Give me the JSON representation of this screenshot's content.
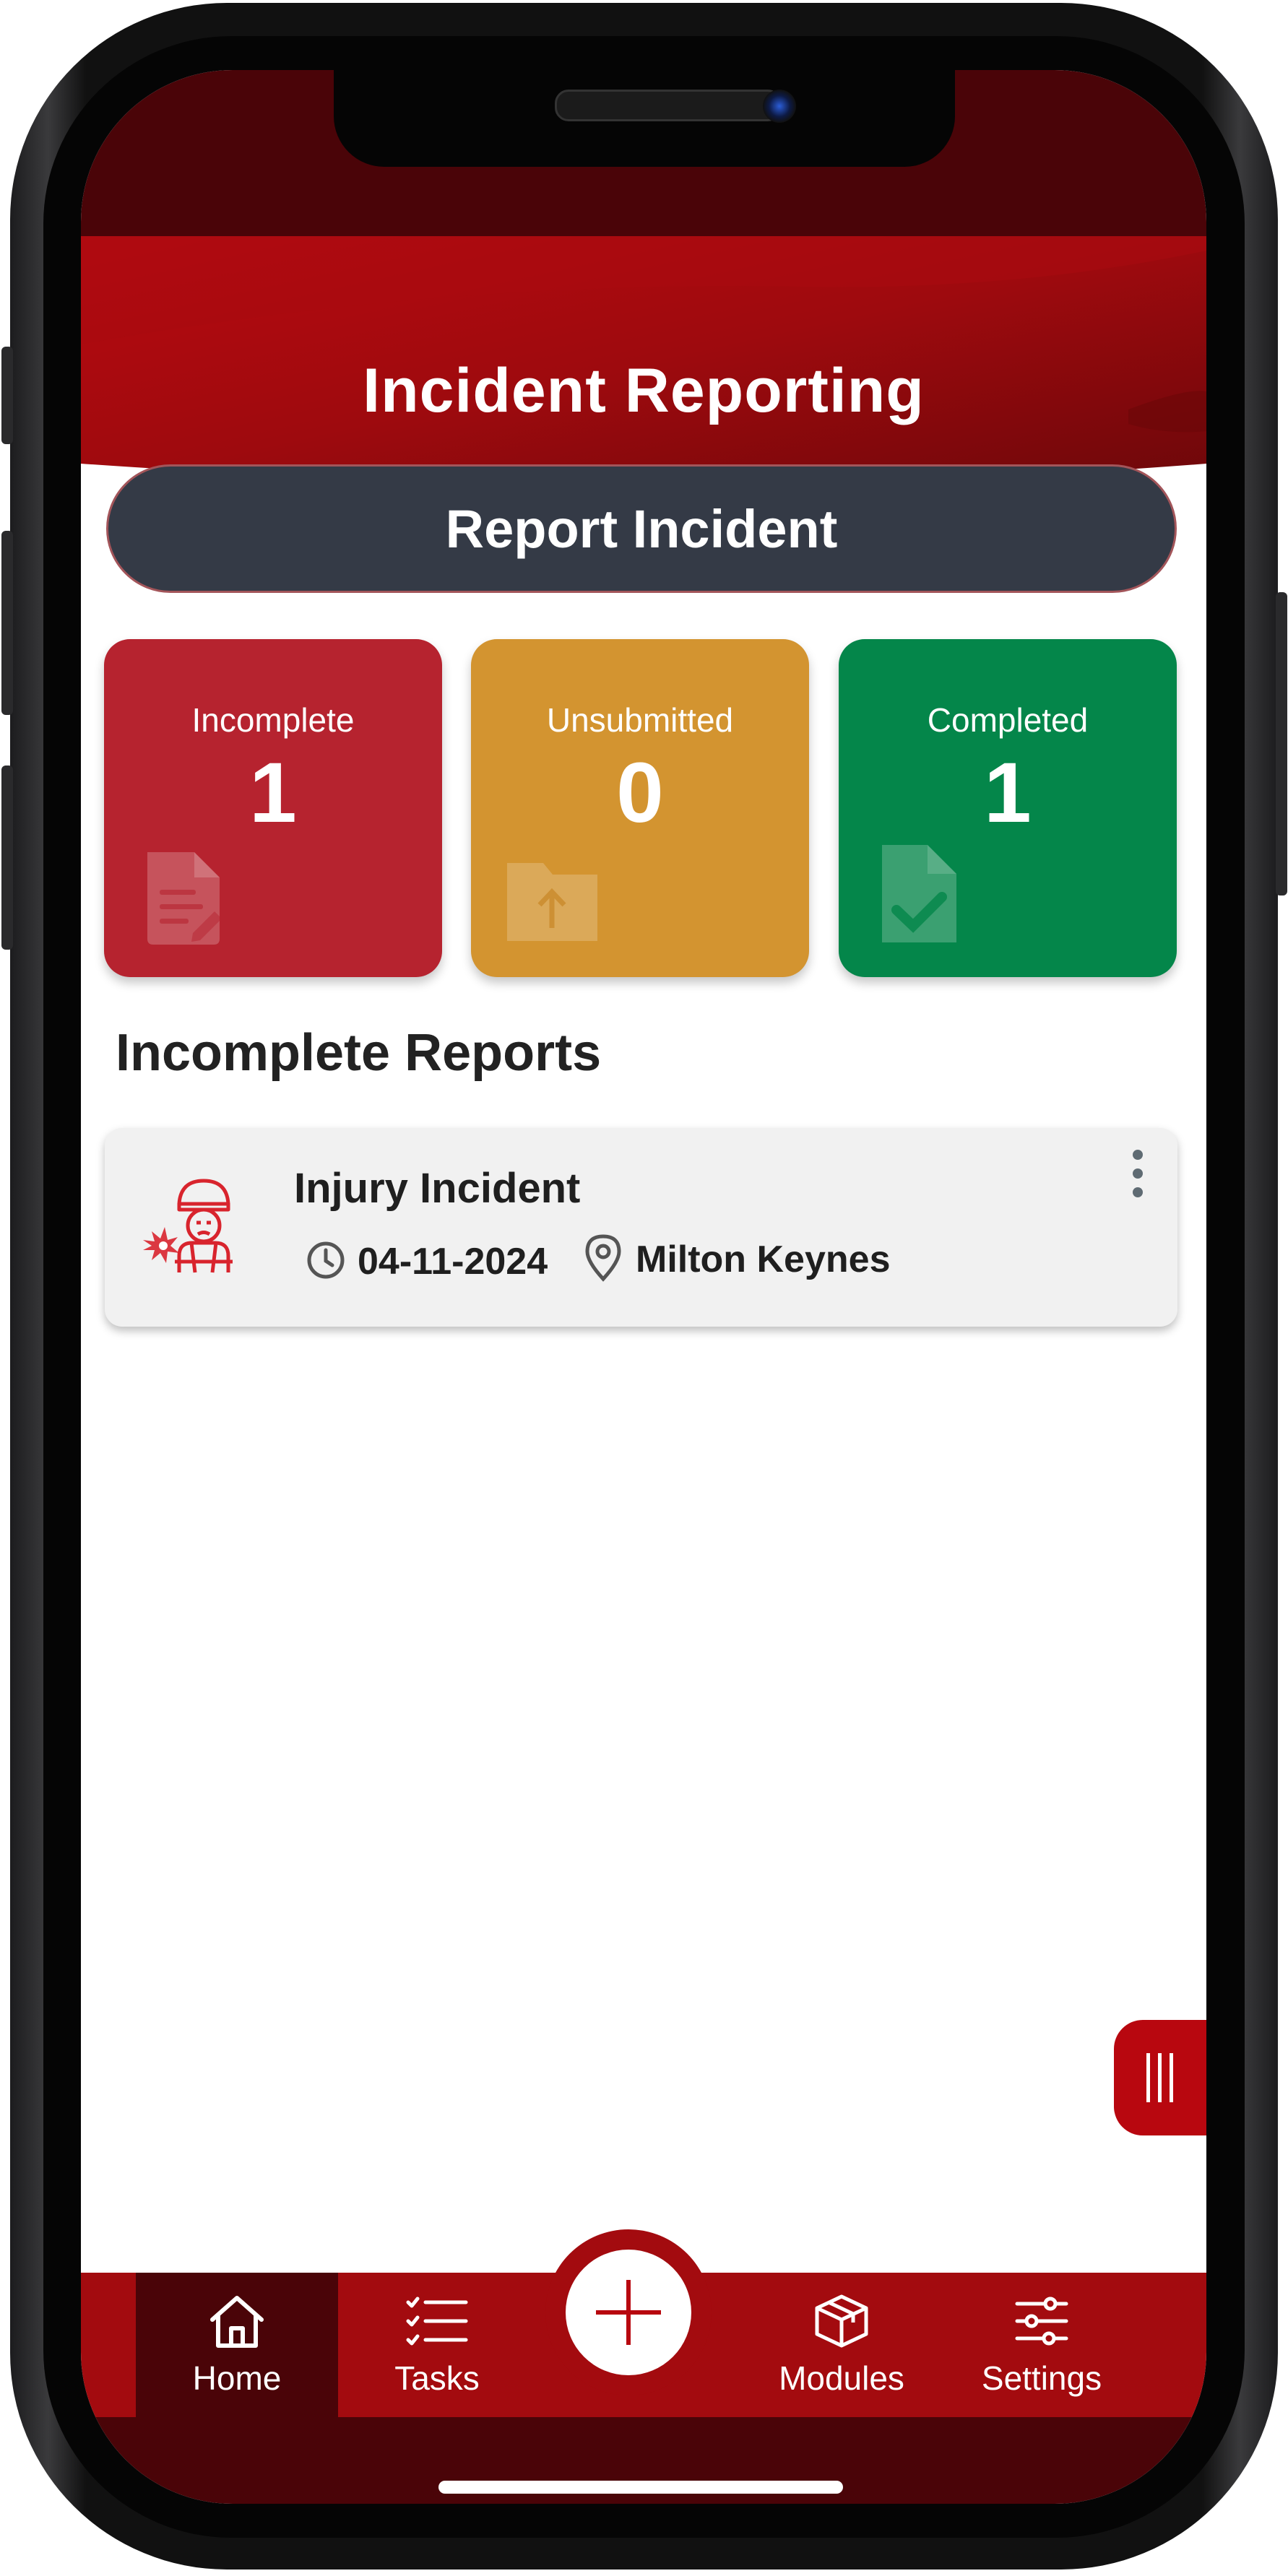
{
  "header": {
    "title": "Incident Reporting"
  },
  "report_button": {
    "label": "Report Incident"
  },
  "summary_cards": [
    {
      "label": "Incomplete",
      "count": "1",
      "color": "#b6232f",
      "icon": "document-edit-icon"
    },
    {
      "label": "Unsubmitted",
      "count": "0",
      "color": "#d39430",
      "icon": "folder-upload-icon"
    },
    {
      "label": "Completed",
      "count": "1",
      "color": "#04864a",
      "icon": "document-check-icon"
    }
  ],
  "section": {
    "title": "Incomplete Reports"
  },
  "reports": [
    {
      "title": "Injury Incident",
      "date": "04-11-2024",
      "location": "Milton Keynes",
      "icon": "injured-person-icon"
    }
  ],
  "bottom_nav": {
    "items": [
      {
        "label": "Home",
        "icon": "home-icon",
        "active": true
      },
      {
        "label": "Tasks",
        "icon": "tasks-list-icon",
        "active": false
      },
      {
        "label": "Modules",
        "icon": "box-icon",
        "active": false
      },
      {
        "label": "Settings",
        "icon": "sliders-icon",
        "active": false
      }
    ],
    "fab_icon": "plus-icon"
  },
  "colors": {
    "brand_red": "#a30b0f",
    "dark_red": "#4a0408",
    "button_dark": "#343a46"
  }
}
